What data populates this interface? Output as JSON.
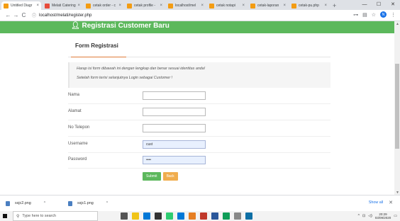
{
  "browser": {
    "tabs": [
      {
        "label": "Untitled Diagr",
        "color": "#f39c12"
      },
      {
        "label": "Melati Catering",
        "color": "#e74c3c"
      },
      {
        "label": "cetak order - c",
        "color": "#f39c12"
      },
      {
        "label": "cetak profile -",
        "color": "#f39c12"
      },
      {
        "label": "localhost/mel",
        "color": "#f39c12"
      },
      {
        "label": "cetak notapi",
        "color": "#f39c12"
      },
      {
        "label": "cetak-laporan",
        "color": "#f39c12"
      },
      {
        "label": "cetak-pu.php",
        "color": "#f39c12"
      }
    ],
    "new_tab": "+",
    "url": "localhost/melati/register.php",
    "avatar_letter": "N"
  },
  "page": {
    "banner_title": "Registrasi Customer Baru",
    "form_title": "Form Registrasi",
    "notice_line1": "Harap isi form dibawah ini dengan lengkap dan benar sesuai identitas anda!",
    "notice_line2": "Setelah form terisi selanjutnya Login sebagai Customer !",
    "fields": {
      "nama": {
        "label": "Nama",
        "value": ""
      },
      "alamat": {
        "label": "Alamat",
        "value": ""
      },
      "telepon": {
        "label": "No Telepon",
        "value": ""
      },
      "username": {
        "label": "Username",
        "value": "cust"
      },
      "password": {
        "label": "Password",
        "value": "••••"
      }
    },
    "submit_label": "Submit",
    "back_label": "Back"
  },
  "downloads": {
    "items": [
      {
        "name": "ssjc2.png"
      },
      {
        "name": "ssjc1.png"
      }
    ],
    "show_all": "Show all"
  },
  "taskbar": {
    "search_placeholder": "Type here to search",
    "time": "20:29",
    "date": "03/09/2020",
    "icon_colors": [
      "#555555",
      "#f0c419",
      "#0078d7",
      "#333333",
      "#2ecc71",
      "#0078d7",
      "#e67e22",
      "#c0392b",
      "#2b579a",
      "#0f9d58",
      "#888888",
      "#0e6fa5"
    ]
  },
  "colors": {
    "banner": "#5cb85c",
    "submit": "#5cb85c",
    "back": "#f0ad4e",
    "accent": "#e07b39"
  }
}
